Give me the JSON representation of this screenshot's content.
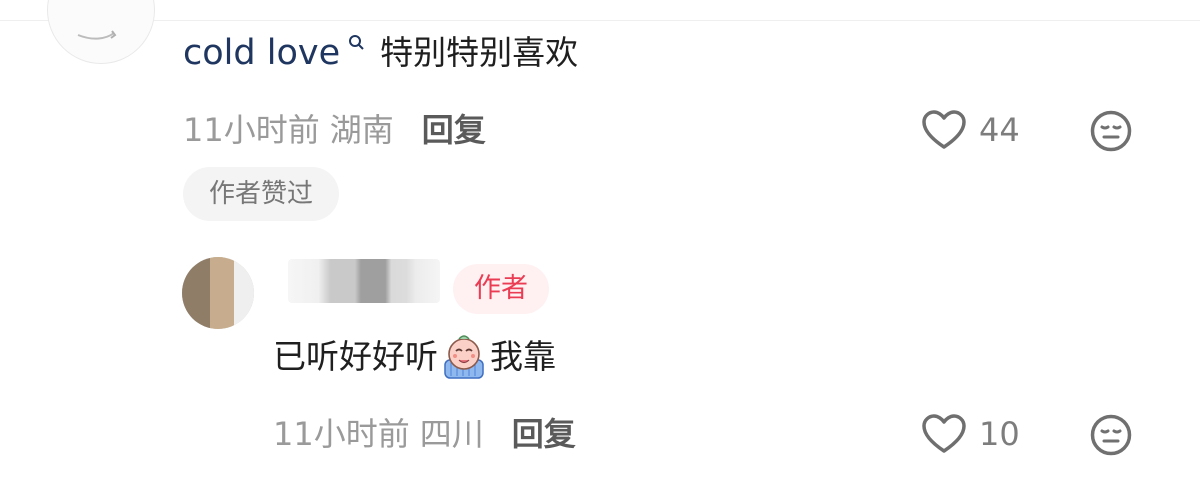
{
  "comments": [
    {
      "username": "cold love",
      "text": "特别特别喜欢",
      "time": "11小时前",
      "region": "湖南",
      "reply_label": "回复",
      "likes": "44",
      "badge": "作者赞过",
      "icons": {
        "like": "heart-icon",
        "reaction": "neutral-face-icon",
        "search": "search-hint-icon"
      }
    }
  ],
  "reply": {
    "author_tag": "作者",
    "text_before": "已听好好听",
    "emoji": "crying-face-emoji",
    "text_after": "我靠",
    "time": "11小时前",
    "region": "四川",
    "reply_label": "回复",
    "likes": "10"
  },
  "colors": {
    "username": "#1f3660",
    "meta": "#9a9a9a",
    "author_tag_bg": "#fff0f2",
    "author_tag_text": "#ea3d54",
    "badge_bg": "#f4f4f4"
  }
}
